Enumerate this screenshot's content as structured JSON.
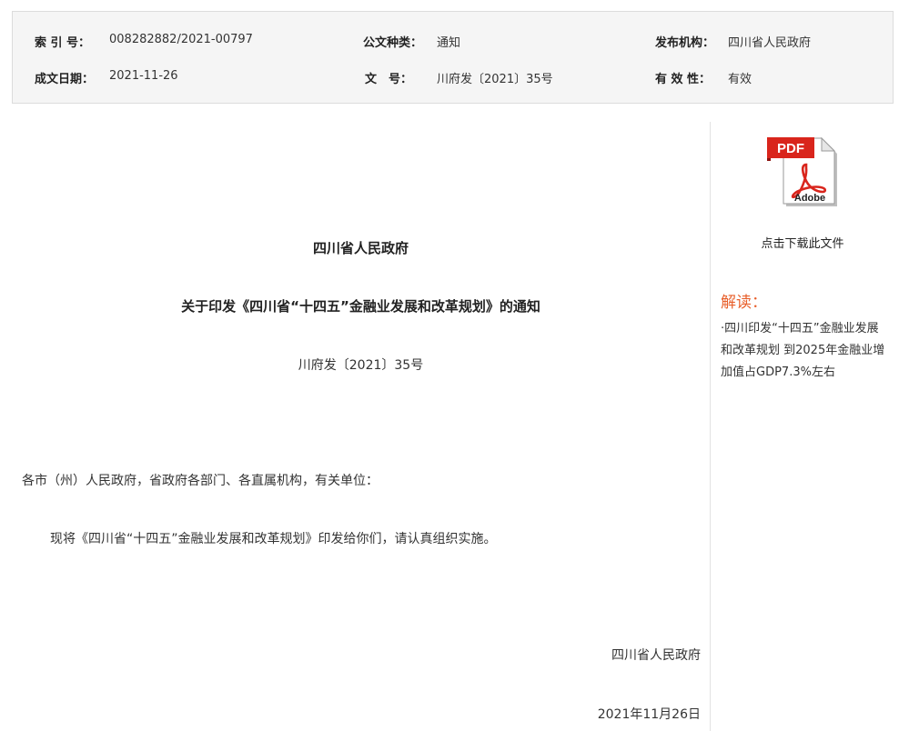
{
  "meta": {
    "index_label": "索 引 号：",
    "index_value": "008282882/2021-00797",
    "category_label": "公文种类：",
    "category_value": "通知",
    "publisher_label": "发布机构：",
    "publisher_value": "四川省人民政府",
    "date_label": "成文日期：",
    "date_value": "2021-11-26",
    "docno_label": "文　号：",
    "docno_value": "川府发〔2021〕35号",
    "validity_label": "有 效 性：",
    "validity_value": "有效"
  },
  "document": {
    "issuer": "四川省人民政府",
    "title": "关于印发《四川省“十四五”金融业发展和改革规划》的通知",
    "number": "川府发〔2021〕35号",
    "salutation": "各市（州）人民政府，省政府各部门、各直属机构，有关单位：",
    "body": "现将《四川省“十四五”金融业发展和改革规划》印发给你们，请认真组织实施。",
    "signer": "四川省人民政府",
    "date": "2021年11月26日"
  },
  "sidebar": {
    "pdf_icon_label": "PDF",
    "pdf_icon_brand": "Adobe",
    "download_label": "点击下载此文件",
    "interpretation_heading": "解读：",
    "interpretation_link": "·四川印发“十四五”金融业发展和改革规划 到2025年金融业增加值占GDP7.3%左右"
  },
  "colors": {
    "accent": "#e8602c",
    "pdf_red": "#d9251c",
    "meta_bg": "#f5f5f5"
  }
}
